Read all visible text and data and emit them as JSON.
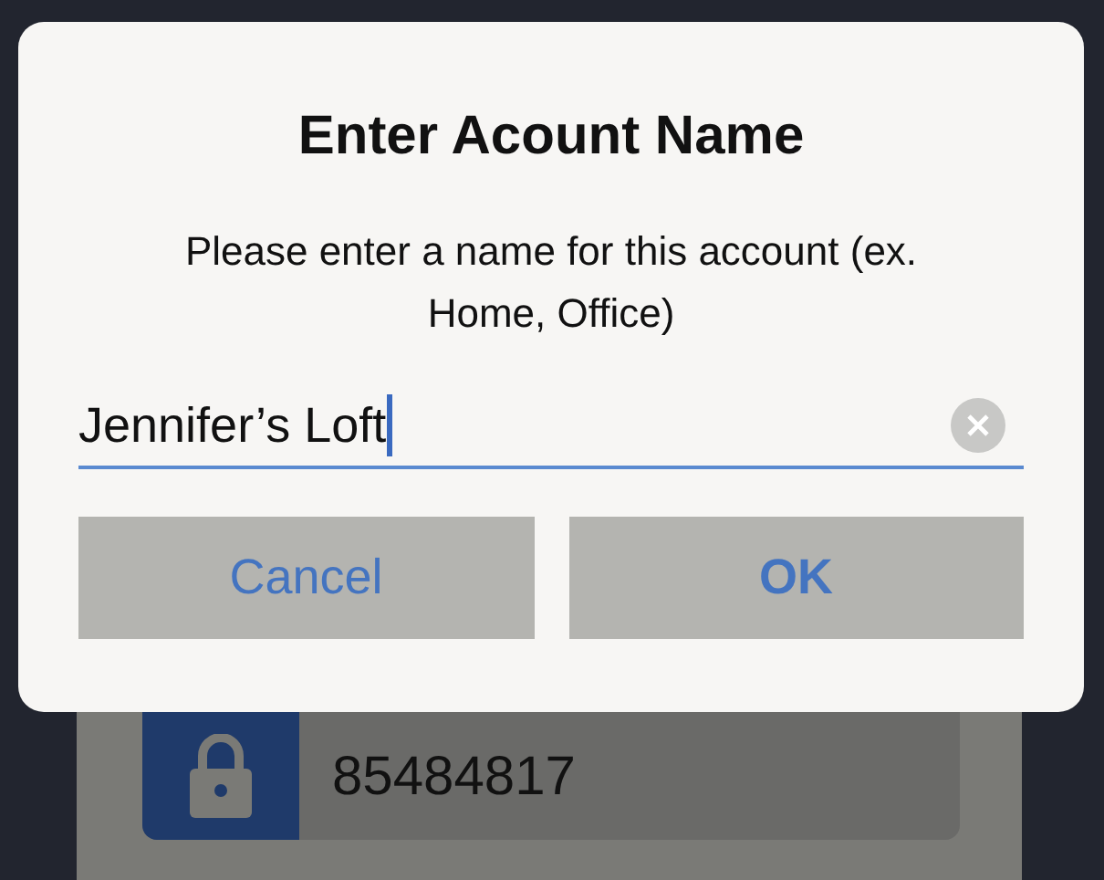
{
  "dialog": {
    "title": "Enter Acount Name",
    "message": "Please enter a name for this account (ex. Home, Office)",
    "field": {
      "value": "Jennifer’s Loft",
      "focused": true
    },
    "buttons": [
      {
        "label": "Cancel",
        "default": false
      },
      {
        "label": "OK",
        "default": true
      }
    ]
  },
  "background": {
    "account_field": {
      "value": "85484817"
    }
  }
}
